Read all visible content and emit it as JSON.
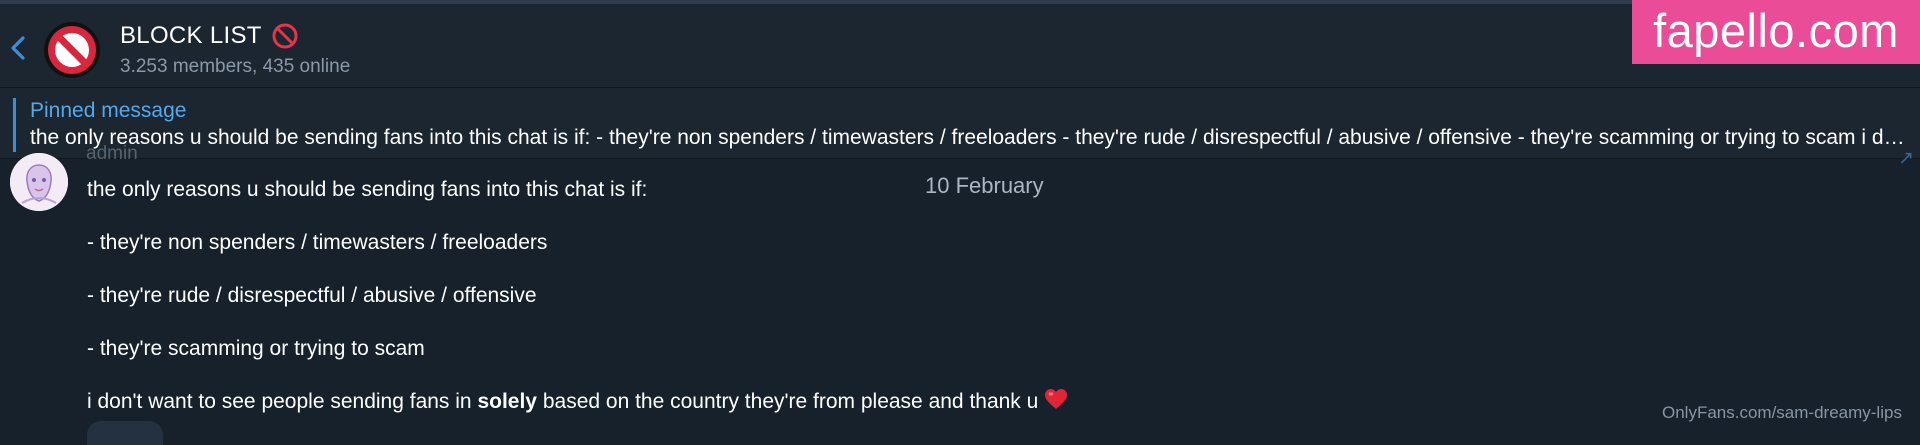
{
  "header": {
    "title": "BLOCK LIST",
    "subtitle": "3.253 members, 435 online",
    "title_icon": "no-entry-emoji"
  },
  "pinned": {
    "label": "Pinned message",
    "text": "the only reasons u should be sending fans into this chat is if:  - they're non spenders / timewasters / freeloaders  - they're rude / disrespectful / abusive / offensive  - they're scamming or trying to scam  i don't want to see people sending fans in solely based on the country they're from please and thank u"
  },
  "message": {
    "sender_role": "admin",
    "date": "10 February",
    "lines": [
      "the only reasons u should be sending fans into this chat is if:",
      "- they're non spenders / timewasters / freeloaders",
      "- they're rude / disrespectful / abusive / offensive",
      "- they're scamming or trying to scam"
    ],
    "last_line": {
      "before": "i don't want to see people sending fans in ",
      "bold": "solely",
      "after": " based on the country they're from please and thank u",
      "emoji": "red-heart-emoji"
    }
  },
  "watermarks": {
    "top": "fapello.com",
    "bottom": "OnlyFans.com/sam-dreamy-lips"
  },
  "colors": {
    "background": "#17212b",
    "header": "#1b2631",
    "accent": "#56a8eb",
    "muted_text": "#8a98a8",
    "watermark_pink": "#eb4c98",
    "no_entry_red": "#d7263d"
  }
}
